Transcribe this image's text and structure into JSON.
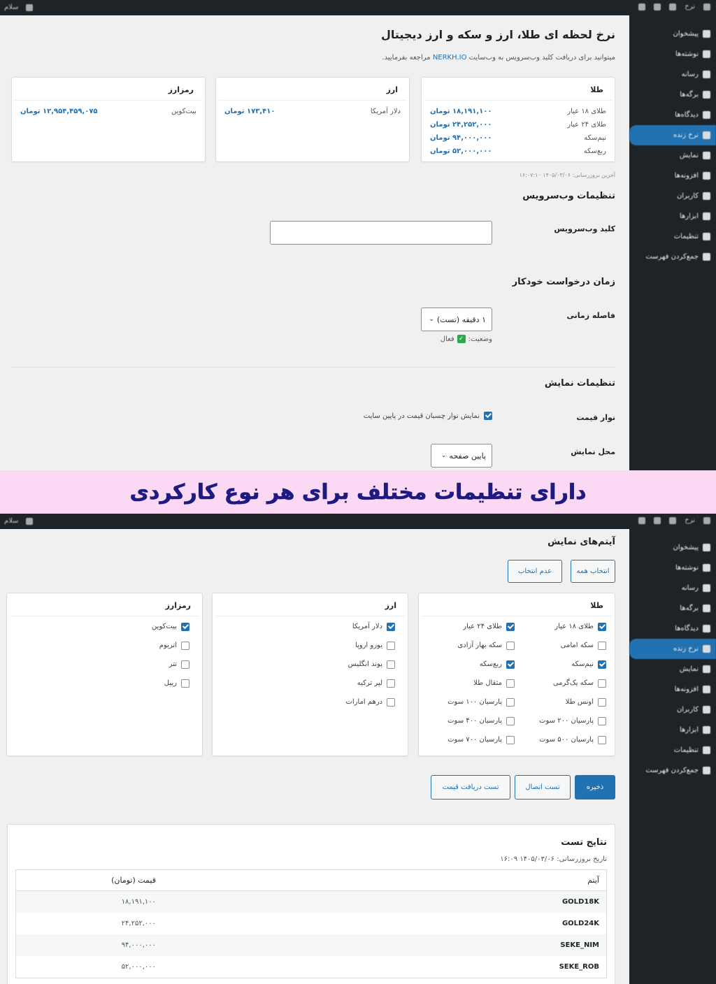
{
  "adminbar": {
    "site": "نرخ",
    "greeting": "سلام"
  },
  "sidebar": {
    "items": [
      "پیشخوان",
      "نوشته‌ها",
      "رسانه",
      "برگه‌ها",
      "دیدگاه‌ها",
      "نرخ زنده",
      "نمایش",
      "افزونه‌ها",
      "کاربران",
      "ابزارها",
      "تنظیمات",
      "جمع‌کردن فهرست"
    ]
  },
  "page1": {
    "title": "نرخ لحظه ای طلا، ارز و سکه و ارز دیجیتال",
    "subtitle_before": "میتوانید برای دریافت کلید وب‌سرویس به وب‌سایت",
    "subtitle_link": "NERKH.IO",
    "subtitle_after": "مراجعه بفرمایید.",
    "gold_card": {
      "title": "طلا",
      "rows": [
        {
          "label": "طلای ۱۸ عیار",
          "value": "۱۸,۱۹۱,۱۰۰ تومان"
        },
        {
          "label": "طلای ۲۴ عیار",
          "value": "۲۴,۲۵۲,۰۰۰ تومان"
        },
        {
          "label": "نیم‌سکه",
          "value": "۹۴,۰۰۰,۰۰۰ تومان"
        },
        {
          "label": "ربع‌سکه",
          "value": "۵۲,۰۰۰,۰۰۰ تومان"
        }
      ]
    },
    "currency_card": {
      "title": "ارز",
      "rows": [
        {
          "label": "دلار آمریکا",
          "value": "۱۷۳,۴۱۰ تومان"
        }
      ]
    },
    "crypto_card": {
      "title": "رمزارز",
      "rows": [
        {
          "label": "بیت‌کوین",
          "value": "۱۲,۹۵۴,۴۵۹,۰۷۵ تومان"
        }
      ]
    },
    "last_update": "آخرین بروزرسانی: ۱۴۰۵/۰۳/۰۶ ۱۶:۰۷:۱۰",
    "ws_section": "تنظیمات وب‌سرویس",
    "ws_key_label": "کلید وب‌سرویس",
    "ws_key_value": "",
    "auto_section": "زمان درخواست خودکار",
    "interval_label": "فاصله زمانی",
    "interval_value": "۱ دقیقه (تست)",
    "status_label": "وضعیت:",
    "status_value": "فعال",
    "display_section": "تنظیمات نمایش",
    "price_bar_label": "نوار قیمت",
    "price_bar_check": "نمایش نوار چسبان قیمت در پایین سایت",
    "position_label": "محل نمایش",
    "position_value": "پایین صفحه"
  },
  "banner": "دارای تنظیمات مختلف برای هر نوع کارکردی",
  "page2": {
    "items_section": "آیتم‌های نمایش",
    "select_all": "انتخاب همه",
    "deselect_all": "عدم انتخاب",
    "gold": {
      "title": "طلا",
      "items": [
        {
          "label": "طلای ۱۸ عیار",
          "checked": true
        },
        {
          "label": "طلای ۲۴ عیار",
          "checked": true
        },
        {
          "label": "سکه امامی",
          "checked": false
        },
        {
          "label": "سکه بهار آزادی",
          "checked": false
        },
        {
          "label": "نیم‌سکه",
          "checked": true
        },
        {
          "label": "ربع‌سکه",
          "checked": true
        },
        {
          "label": "سکه یک‌گرمی",
          "checked": false
        },
        {
          "label": "مثقال طلا",
          "checked": false
        },
        {
          "label": "اونس طلا",
          "checked": false
        },
        {
          "label": "پارسیان ۱۰۰ سوت",
          "checked": false
        },
        {
          "label": "پارسیان ۲۰۰ سوت",
          "checked": false
        },
        {
          "label": "پارسیان ۴۰۰ سوت",
          "checked": false
        },
        {
          "label": "پارسیان ۵۰۰ سوت",
          "checked": false
        },
        {
          "label": "پارسیان ۷۰۰ سوت",
          "checked": false
        }
      ]
    },
    "currency": {
      "title": "ارز",
      "items": [
        {
          "label": "دلار آمریکا",
          "checked": true
        },
        {
          "label": "یورو اروپا",
          "checked": false
        },
        {
          "label": "پوند انگلیس",
          "checked": false
        },
        {
          "label": "لیر ترکیه",
          "checked": false
        },
        {
          "label": "درهم امارات",
          "checked": false
        }
      ]
    },
    "crypto": {
      "title": "رمزارز",
      "items": [
        {
          "label": "بیت‌کوین",
          "checked": true
        },
        {
          "label": "اتریوم",
          "checked": false
        },
        {
          "label": "تتر",
          "checked": false
        },
        {
          "label": "ریپل",
          "checked": false
        }
      ]
    },
    "save": "ذخیره",
    "test_connection": "تست اتصال",
    "test_price": "تست دریافت قیمت",
    "results_title": "نتایج تست",
    "results_date": "تاریخ بروزرسانی: ۱۴۰۵/۰۳/۰۶ ۱۶:۰۹",
    "table": {
      "headers": [
        "آیتم",
        "قیمت (تومان)"
      ],
      "rows": [
        [
          "GOLD18K",
          "۱۸,۱۹۱,۱۰۰"
        ],
        [
          "GOLD24K",
          "۲۴,۲۵۲,۰۰۰"
        ],
        [
          "SEKE_NIM",
          "۹۴,۰۰۰,۰۰۰"
        ],
        [
          "SEKE_ROB",
          "۵۲,۰۰۰,۰۰۰"
        ]
      ]
    }
  }
}
